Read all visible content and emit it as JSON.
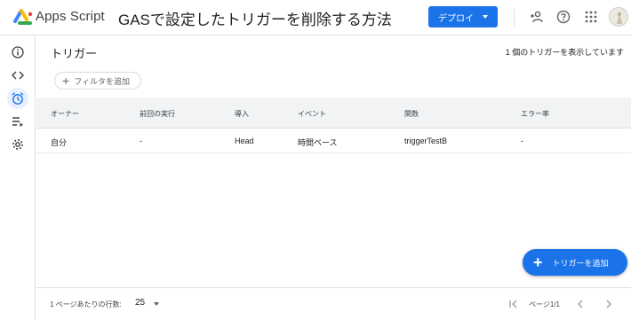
{
  "header": {
    "app_name": "Apps Script",
    "project_title": "GASで設定したトリガーを削除する方法",
    "deploy_label": "デプロイ",
    "icons": [
      "add-person-icon",
      "help-icon",
      "apps-grid-icon",
      "account-avatar"
    ]
  },
  "rail": {
    "items": [
      {
        "icon": "info-icon",
        "active": false
      },
      {
        "icon": "code-icon",
        "active": false
      },
      {
        "icon": "alarm-clock-icon",
        "active": true
      },
      {
        "icon": "executions-icon",
        "active": false
      },
      {
        "icon": "gear-icon",
        "active": false
      }
    ]
  },
  "main": {
    "title": "トリガー",
    "count_text": "1 個のトリガーを表示しています",
    "filter_label": "フィルタを追加",
    "columns": [
      "オーナー",
      "前回の実行",
      "導入",
      "イベント",
      "関数",
      "エラー率"
    ],
    "rows": [
      [
        "自分",
        "-",
        "Head",
        "時間ベース",
        "triggerTestB",
        "-"
      ]
    ],
    "fab_label": "トリガーを追加"
  },
  "footer": {
    "rows_per_page_label": "1 ページあたりの行数:",
    "rows_per_page_value": "25",
    "page_info": "ページ1/1"
  },
  "colors": {
    "accent": "#1a73e8",
    "rail_active": "#e8f0fe",
    "header_bg": "#f1f3f4"
  }
}
